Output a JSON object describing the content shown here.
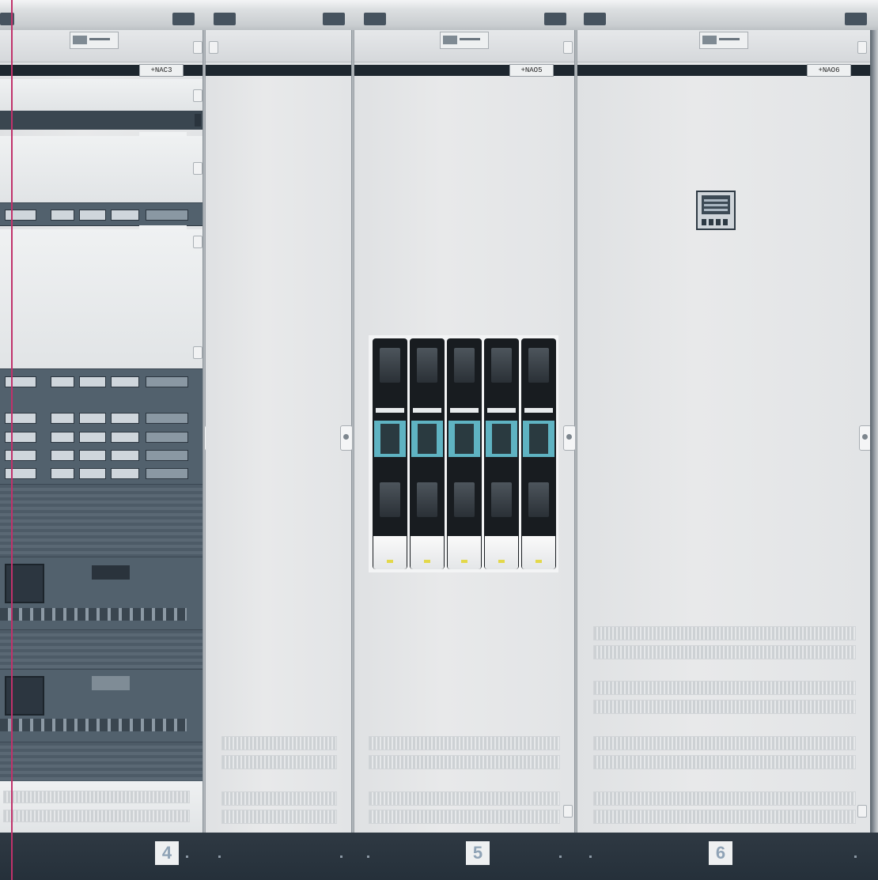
{
  "sections": [
    {
      "id": "left",
      "tag": "+NAC3",
      "number": "4"
    },
    {
      "id": "middle-narrow",
      "tag": "",
      "number": ""
    },
    {
      "id": "fuse-section",
      "tag": "+NAO5",
      "number": "5"
    },
    {
      "id": "right",
      "tag": "+NAO6",
      "number": "6"
    }
  ],
  "colors": {
    "panel": "#e6e8ea",
    "equipment": "#52616d",
    "base": "#2b3540",
    "fuse-accent": "#5fb3c2",
    "guide-line": "#c0326b"
  },
  "fuse_count": 5
}
